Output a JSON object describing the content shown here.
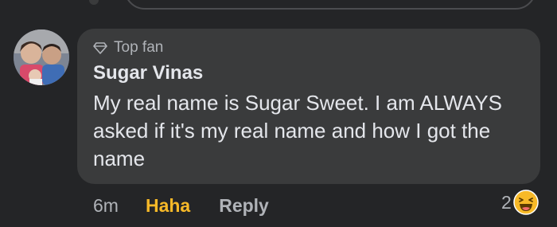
{
  "comment": {
    "badge_icon": "diamond-icon",
    "badge_label": "Top fan",
    "author": "Sugar Vinas",
    "text": "My real name is Sugar Sweet. I am ALWAYS asked if it's my real name and how I got the name"
  },
  "actions": {
    "time": "6m",
    "reaction_label": "Haha",
    "reply_label": "Reply"
  },
  "reactions": {
    "count": "2",
    "icon": "laughing-face-icon"
  },
  "colors": {
    "background": "#242527",
    "bubble": "#3a3b3c",
    "haha_accent": "#f7b928",
    "primary_text": "#e4e6eb",
    "secondary_text": "#b0b3b8"
  }
}
